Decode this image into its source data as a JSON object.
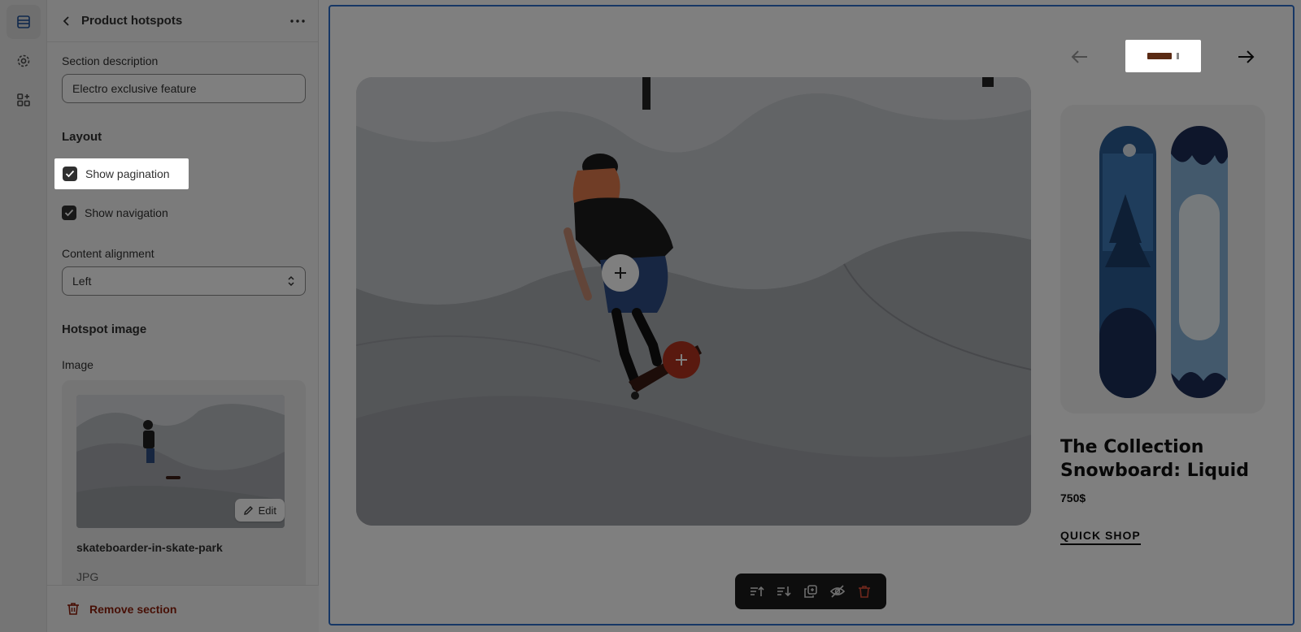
{
  "sidebar": {
    "header_title": "Product hotspots",
    "section_description_label": "Section description",
    "section_description_value": "Electro exclusive feature",
    "layout_heading": "Layout",
    "show_pagination_label": "Show pagination",
    "show_pagination_checked": true,
    "show_navigation_label": "Show navigation",
    "show_navigation_checked": true,
    "content_alignment_label": "Content alignment",
    "content_alignment_value": "Left",
    "hotspot_image_heading": "Hotspot image",
    "image_label": "Image",
    "edit_label": "Edit",
    "file_name": "skateboarder-in-skate-park",
    "file_type": "JPG",
    "remove_section_label": "Remove section"
  },
  "preview": {
    "product_title": "The Collection Snowboard: Liquid",
    "product_price": "750$",
    "quick_shop_label": "QUICK SHOP"
  },
  "colors": {
    "accent_frame": "#2c6ecb",
    "hotspot_active": "#b3321f",
    "remove_text": "#8e1f0b"
  }
}
